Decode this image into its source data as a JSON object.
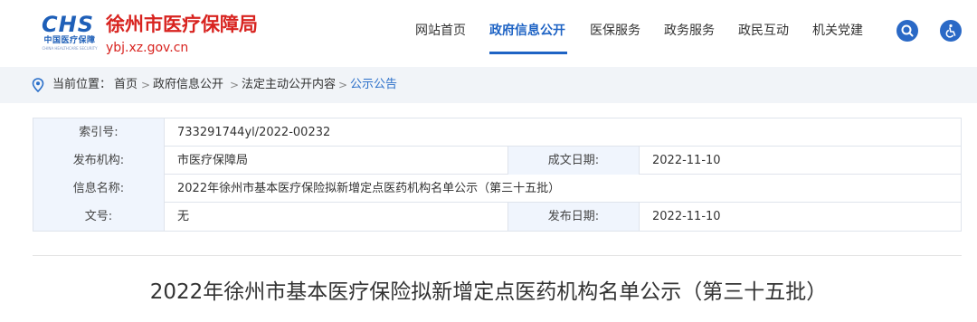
{
  "header": {
    "logo_mark": "CHS",
    "logo_cn": "中国医疗保障",
    "logo_en": "CHINA HEALTHCARE SECURITY",
    "site_title": "徐州市医疗保障局",
    "site_domain": "ybj.xz.gov.cn"
  },
  "nav": {
    "items": [
      {
        "label": "网站首页",
        "active": false
      },
      {
        "label": "政府信息公开",
        "active": true
      },
      {
        "label": "医保服务",
        "active": false
      },
      {
        "label": "政务服务",
        "active": false
      },
      {
        "label": "政民互动",
        "active": false
      },
      {
        "label": "机关党建",
        "active": false
      }
    ],
    "icons": [
      "search-icon",
      "accessibility-icon"
    ]
  },
  "breadcrumb": {
    "label": "当前位置：",
    "items": [
      "首页",
      "政府信息公开",
      "法定主动公开内容",
      "公示公告"
    ],
    "separator": ">"
  },
  "meta": {
    "index_label": "索引号:",
    "index_value": "733291744yl/2022-00232",
    "publisher_label": "发布机构:",
    "publisher_value": "市医疗保障局",
    "created_label": "成文日期:",
    "created_value": "2022-11-10",
    "name_label": "信息名称:",
    "name_value": "2022年徐州市基本医疗保险拟新增定点医药机构名单公示（第三十五批）",
    "doc_label": "文号:",
    "doc_value": "无",
    "published_label": "发布日期:",
    "published_value": "2022-11-10"
  },
  "article": {
    "title": "2022年徐州市基本医疗保险拟新增定点医药机构名单公示（第三十五批）"
  },
  "colors": {
    "brand_red": "#d8231f",
    "accent_blue": "#1e63c4",
    "label_bg": "#f0f5fd",
    "breadcrumb_bg": "#f1f4f8"
  }
}
